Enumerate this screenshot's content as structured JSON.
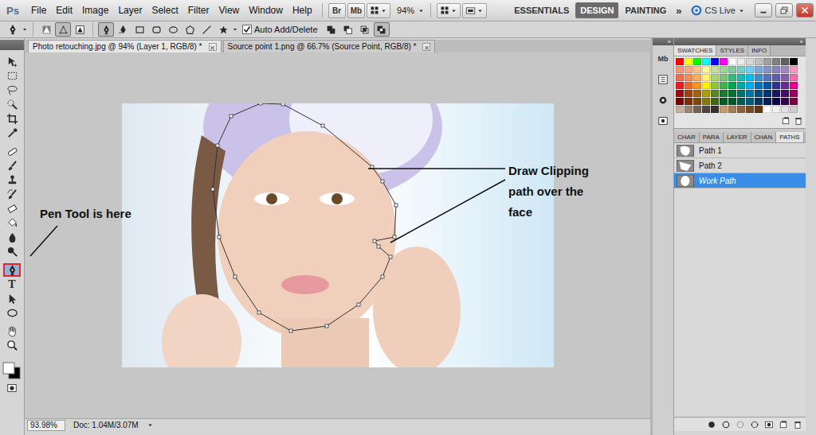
{
  "app": {
    "logo": "Ps"
  },
  "menu": [
    "File",
    "Edit",
    "Image",
    "Layer",
    "Select",
    "Filter",
    "View",
    "Window",
    "Help"
  ],
  "app_bar": {
    "bridge": "Br",
    "mini_bridge": "Mb",
    "zoom": "94%",
    "workspaces": [
      {
        "label": "ESSENTIALS",
        "selected": false
      },
      {
        "label": "DESIGN",
        "selected": true
      },
      {
        "label": "PAINTING",
        "selected": false
      }
    ],
    "more": "»",
    "cs_live": "CS Live"
  },
  "options_bar": {
    "modes": [
      {
        "kind": "shape-layers",
        "selected": false
      },
      {
        "kind": "paths",
        "selected": true
      },
      {
        "kind": "fill-pixels",
        "selected": false
      }
    ],
    "shapes": [
      {
        "kind": "pen",
        "selected": true
      },
      {
        "kind": "freeform",
        "selected": false
      },
      {
        "kind": "rect",
        "selected": false
      },
      {
        "kind": "rounded",
        "selected": false
      },
      {
        "kind": "ellipse",
        "selected": false
      },
      {
        "kind": "polygon",
        "selected": false
      },
      {
        "kind": "line",
        "selected": false
      },
      {
        "kind": "custom",
        "selected": false
      }
    ],
    "auto_add_delete": {
      "label": "Auto Add/Delete",
      "checked": true
    },
    "path_ops": [
      {
        "kind": "op-add",
        "selected": false
      },
      {
        "kind": "op-subtract",
        "selected": false
      },
      {
        "kind": "op-intersect",
        "selected": false
      },
      {
        "kind": "op-exclude",
        "selected": true
      }
    ]
  },
  "tools": [
    {
      "kind": "move",
      "selected": false,
      "group": 1
    },
    {
      "kind": "marquee",
      "selected": false,
      "group": 1
    },
    {
      "kind": "lasso",
      "selected": false,
      "group": 1
    },
    {
      "kind": "quick-select",
      "selected": false,
      "group": 1
    },
    {
      "kind": "crop",
      "selected": false,
      "group": 1
    },
    {
      "kind": "eyedropper",
      "selected": false,
      "group": 1
    },
    {
      "kind": "healing",
      "selected": false,
      "group": 2
    },
    {
      "kind": "brush",
      "selected": false,
      "group": 2
    },
    {
      "kind": "stamp",
      "selected": false,
      "group": 2
    },
    {
      "kind": "history",
      "selected": false,
      "group": 2
    },
    {
      "kind": "eraser",
      "selected": false,
      "group": 2
    },
    {
      "kind": "bucket",
      "selected": false,
      "group": 2
    },
    {
      "kind": "blur",
      "selected": false,
      "group": 2
    },
    {
      "kind": "dodge",
      "selected": false,
      "group": 2
    },
    {
      "kind": "pen",
      "selected": true,
      "group": 3
    },
    {
      "kind": "type",
      "selected": false,
      "group": 3,
      "glyph": "T"
    },
    {
      "kind": "path-select",
      "selected": false,
      "group": 3
    },
    {
      "kind": "ellipse",
      "selected": false,
      "group": 3
    },
    {
      "kind": "hand",
      "selected": false,
      "group": 4
    },
    {
      "kind": "zoom",
      "selected": false,
      "group": 4
    }
  ],
  "documents": [
    {
      "title": "Photo retouching.jpg @ 94% (Layer 1, RGB/8) *",
      "selected": true,
      "close": "×"
    },
    {
      "title": "Source point 1.png @ 66.7% (Source Point, RGB/8) *",
      "selected": false,
      "close": "×"
    }
  ],
  "status_bar": {
    "zoom": "93.98%",
    "doc": "Doc: 1.04M/3.07M"
  },
  "annotations": [
    {
      "text": "Pen Tool is here"
    },
    {
      "text": "Draw Clipping path over the face"
    }
  ],
  "side_column": {
    "mini_bridge": "Mb",
    "more": "»"
  },
  "swatches_panel": {
    "tabs": [
      {
        "label": "SWATCHES",
        "selected": true
      },
      {
        "label": "STYLES",
        "selected": false
      },
      {
        "label": "INFO",
        "selected": false
      }
    ],
    "more": "»",
    "colors": [
      "#ff0000",
      "#ffff00",
      "#00ff00",
      "#00ffff",
      "#0000ff",
      "#ff00ff",
      "#ffffff",
      "#ebebeb",
      "#d6d6d6",
      "#c0c0c0",
      "#a0a0a0",
      "#808080",
      "#606060",
      "#000000",
      "#f7977a",
      "#f9ad81",
      "#fdc68a",
      "#fff79a",
      "#c4df9b",
      "#a3d39c",
      "#82ca9d",
      "#7bcdc8",
      "#6ecff6",
      "#7ea7d8",
      "#8493ca",
      "#8882be",
      "#a187be",
      "#f49ac2",
      "#f26c4f",
      "#f68e55",
      "#fbaf5c",
      "#fff467",
      "#acd372",
      "#7cc576",
      "#3bb878",
      "#1abbb4",
      "#00bff3",
      "#438cca",
      "#5574b9",
      "#605ca8",
      "#855fa8",
      "#f06eaa",
      "#ed1c24",
      "#f26522",
      "#f7941d",
      "#fff200",
      "#8dc73f",
      "#39b54a",
      "#00a651",
      "#00a99d",
      "#00aeef",
      "#0072bc",
      "#0054a6",
      "#2e3192",
      "#662d91",
      "#ec008c",
      "#9e0b0f",
      "#a0410d",
      "#a36209",
      "#aba000",
      "#598527",
      "#1a7b30",
      "#007236",
      "#00746b",
      "#0076a3",
      "#004b80",
      "#003471",
      "#1b1464",
      "#440e62",
      "#9e005d",
      "#790000",
      "#7b2e00",
      "#7d4900",
      "#827b00",
      "#406618",
      "#005e20",
      "#005826",
      "#005952",
      "#005b7f",
      "#003663",
      "#002157",
      "#0d004c",
      "#32004b",
      "#7b0046",
      "#c7b299",
      "#998675",
      "#736357",
      "#534741",
      "#37302d",
      "#c69c6d",
      "#a67c52",
      "#8c6239",
      "#754c24",
      "#603913",
      "#ffffff",
      "#f2f2f2",
      "#e0e0e0",
      "#cfcfcf"
    ]
  },
  "paths_panel": {
    "tabs": [
      {
        "label": "CHAR",
        "selected": false
      },
      {
        "label": "PARA",
        "selected": false
      },
      {
        "label": "LAYER",
        "selected": false
      },
      {
        "label": "CHAN",
        "selected": false
      },
      {
        "label": "PATHS",
        "selected": true
      }
    ],
    "paths": [
      {
        "name": "Path 1",
        "selected": false,
        "kind": "blob"
      },
      {
        "name": "Path 2",
        "selected": false,
        "kind": "wedge"
      },
      {
        "name": "Work Path",
        "selected": true,
        "kind": "face"
      }
    ]
  }
}
